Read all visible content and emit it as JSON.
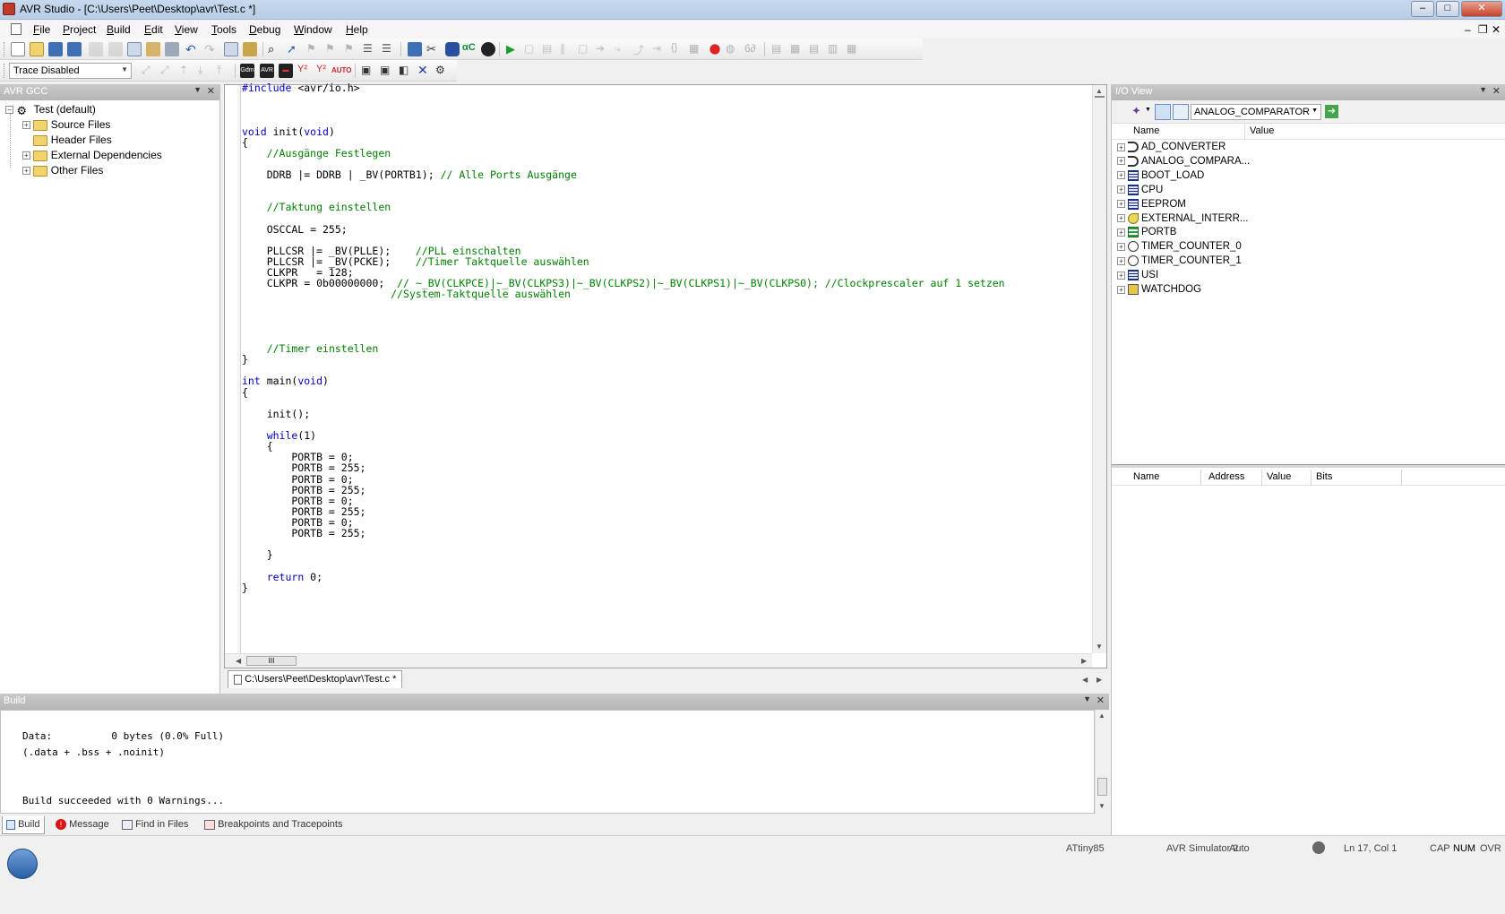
{
  "window": {
    "title": "AVR Studio - [C:\\Users\\Peet\\Desktop\\avr\\Test.c *]"
  },
  "menu": [
    "File",
    "Project",
    "Build",
    "Edit",
    "View",
    "Tools",
    "Debug",
    "Window",
    "Help"
  ],
  "toolbar2": {
    "trace_select": "Trace Disabled"
  },
  "project_panel": {
    "title": "AVR GCC",
    "root": "Test (default)",
    "items": [
      "Source Files",
      "Header Files",
      "External Dependencies",
      "Other Files"
    ]
  },
  "editor": {
    "tab_label": "C:\\Users\\Peet\\Desktop\\avr\\Test.c *",
    "hscroll_grip": "III",
    "lines": [
      "#include <avr/io.h>",
      "",
      "",
      "",
      "void init(void)",
      "{",
      "    //Ausgänge Festlegen",
      "",
      "    DDRB |= DDRB | _BV(PORTB1); // Alle Ports Ausgänge",
      "",
      "",
      "    //Taktung einstellen",
      "",
      "    OSCCAL = 255;",
      "",
      "    PLLCSR |= _BV(PLLE);    //PLL einschalten",
      "    PLLCSR |= _BV(PCKE);    //Timer Taktquelle auswählen",
      "    CLKPR   = 128;",
      "    CLKPR = 0b00000000;  // ~_BV(CLKPCE)|~_BV(CLKPS3)|~_BV(CLKPS2)|~_BV(CLKPS1)|~_BV(CLKPS0); //Clockprescaler auf 1 setzen",
      "                        //System-Taktquelle auswählen",
      "",
      "",
      "",
      "",
      "    //Timer einstellen",
      "}",
      "",
      "int main(void)",
      "{",
      "",
      "    init();",
      "",
      "    while(1)",
      "    {",
      "        PORTB = 0;",
      "        PORTB = 255;",
      "        PORTB = 0;",
      "        PORTB = 255;",
      "        PORTB = 0;",
      "        PORTB = 255;",
      "        PORTB = 0;",
      "        PORTB = 255;",
      "",
      "    }",
      "",
      "    return 0;",
      "}"
    ]
  },
  "build_panel": {
    "title": "Build",
    "output": "Data:          0 bytes (0.0% Full)\n(.data + .bss + .noinit)\n\n\nBuild succeeded with 0 Warnings...",
    "tabs": [
      "Build",
      "Message",
      "Find in Files",
      "Breakpoints and Tracepoints"
    ]
  },
  "io_view": {
    "title": "I/O View",
    "module_select": "ANALOG_COMPARATOR",
    "columns": [
      "Name",
      "Value"
    ],
    "items": [
      {
        "name": "AD_CONVERTER",
        "icon": "analog-icon"
      },
      {
        "name": "ANALOG_COMPARA...",
        "icon": "analog-icon"
      },
      {
        "name": "BOOT_LOAD",
        "icon": "memory-icon"
      },
      {
        "name": "CPU",
        "icon": "memory-icon"
      },
      {
        "name": "EEPROM",
        "icon": "memory-icon"
      },
      {
        "name": "EXTERNAL_INTERR...",
        "icon": "interrupt-icon"
      },
      {
        "name": "PORTB",
        "icon": "port-icon"
      },
      {
        "name": "TIMER_COUNTER_0",
        "icon": "timer-icon"
      },
      {
        "name": "TIMER_COUNTER_1",
        "icon": "timer-icon"
      },
      {
        "name": "USI",
        "icon": "memory-icon"
      },
      {
        "name": "WATCHDOG",
        "icon": "watchdog-icon"
      }
    ],
    "detail_columns": [
      "Name",
      "Address",
      "Value",
      "Bits"
    ]
  },
  "statusbar": {
    "device": "ATtiny85",
    "platform": "AVR Simulator 2",
    "mode": "Auto",
    "cursor": "Ln 17, Col 1",
    "cap": "CAP",
    "num": "NUM",
    "ovr": "OVR"
  },
  "colors": {
    "keyword": "#0000cc",
    "comment": "#008000",
    "panel_header": "#bdbdbd"
  }
}
